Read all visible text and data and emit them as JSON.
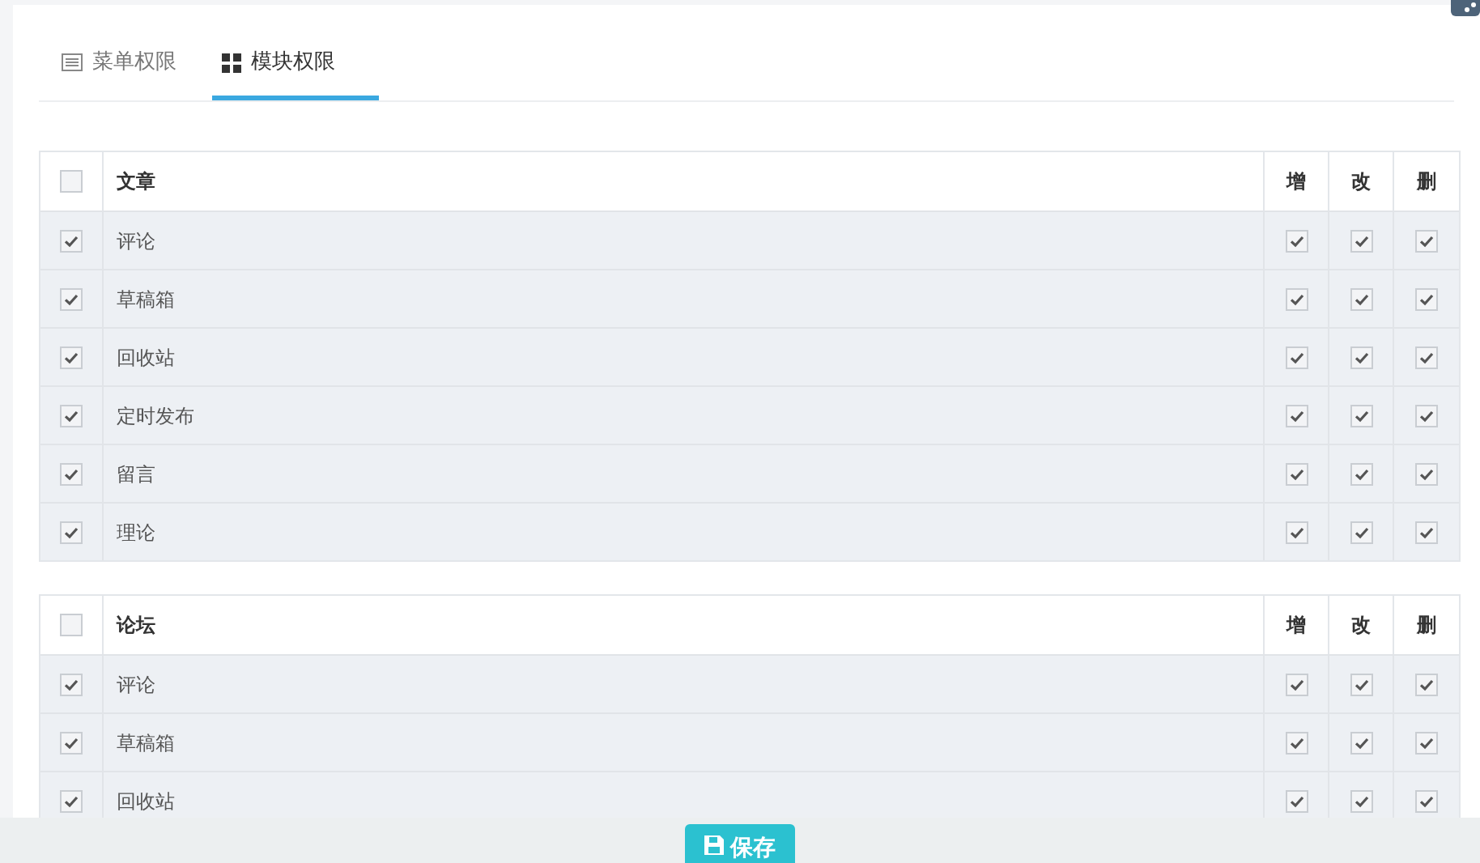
{
  "tabs": [
    {
      "label": "菜单权限",
      "kind": "list",
      "selected": false
    },
    {
      "label": "模块权限",
      "kind": "grid",
      "selected": true
    }
  ],
  "modules": [
    {
      "title": "文章",
      "checked": false,
      "columns": [
        "增",
        "改",
        "删"
      ],
      "rows": [
        {
          "label": "评论",
          "checked": true,
          "perms": [
            true,
            true,
            true
          ]
        },
        {
          "label": "草稿箱",
          "checked": true,
          "perms": [
            true,
            true,
            true
          ]
        },
        {
          "label": "回收站",
          "checked": true,
          "perms": [
            true,
            true,
            true
          ]
        },
        {
          "label": "定时发布",
          "checked": true,
          "perms": [
            true,
            true,
            true
          ]
        },
        {
          "label": "留言",
          "checked": true,
          "perms": [
            true,
            true,
            true
          ]
        },
        {
          "label": "理论",
          "checked": true,
          "perms": [
            true,
            true,
            true
          ]
        }
      ]
    },
    {
      "title": "论坛",
      "checked": false,
      "columns": [
        "增",
        "改",
        "删"
      ],
      "rows": [
        {
          "label": "评论",
          "checked": true,
          "perms": [
            true,
            true,
            true
          ]
        },
        {
          "label": "草稿箱",
          "checked": true,
          "perms": [
            true,
            true,
            true
          ]
        },
        {
          "label": "回收站",
          "checked": true,
          "perms": [
            true,
            true,
            true
          ]
        }
      ]
    }
  ],
  "save_button": "保存"
}
